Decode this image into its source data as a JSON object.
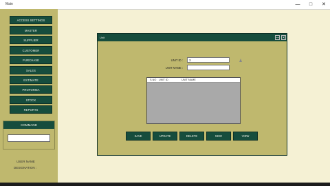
{
  "window": {
    "title": "Main",
    "controls": {
      "minimize": "—",
      "maximize": "□",
      "close": "✕"
    }
  },
  "sidebar": {
    "items": [
      {
        "label": "ACCESS SETTINGS"
      },
      {
        "label": "MASTER"
      },
      {
        "label": "SUPPLIER"
      },
      {
        "label": "CUSTOMER"
      },
      {
        "label": "PURCHASE"
      },
      {
        "label": "SALES"
      },
      {
        "label": "ESTIMATE"
      },
      {
        "label": "PROFORMA"
      },
      {
        "label": "STOCK"
      },
      {
        "label": "REPORTS"
      }
    ],
    "command": {
      "header": "COMMAND",
      "value": ""
    },
    "user_name_label": "USER NAME",
    "designation_label": "DESIGNATION :"
  },
  "unit_window": {
    "title": "Unit",
    "controls": {
      "minimize": "—",
      "close": "✕"
    },
    "unit_id_label": "UNIT ID :",
    "unit_id_value": "3",
    "unit_name_label": "UNIT NAME :",
    "unit_name_value": "",
    "grid_columns": [
      "S.NO",
      "UNIT ID",
      "UNIT NAME"
    ],
    "buttons": {
      "save": "SAVE",
      "update": "UPDATE",
      "delete": "DELETE",
      "new": "NEW",
      "view": "VIEW"
    }
  },
  "colors": {
    "accent": "#164d3d",
    "panel": "#bfb86e",
    "background": "#f5f1d4"
  }
}
